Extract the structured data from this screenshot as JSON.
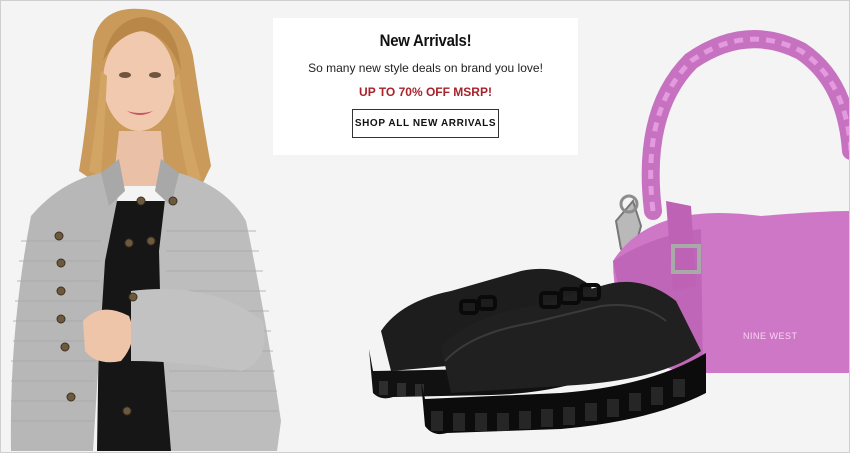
{
  "promo": {
    "title": "New Arrivals!",
    "subtitle": "So many new style deals on brand you love!",
    "deal": "UP TO 70% OFF MSRP!",
    "cta_label": "SHOP ALL NEW ARRIVALS"
  },
  "products": {
    "handbag_brand": "NINE WEST"
  },
  "colors": {
    "deal_red": "#a8222b",
    "handbag_pink": "#cf77c7",
    "jacket_gray": "#b9b9b9"
  }
}
